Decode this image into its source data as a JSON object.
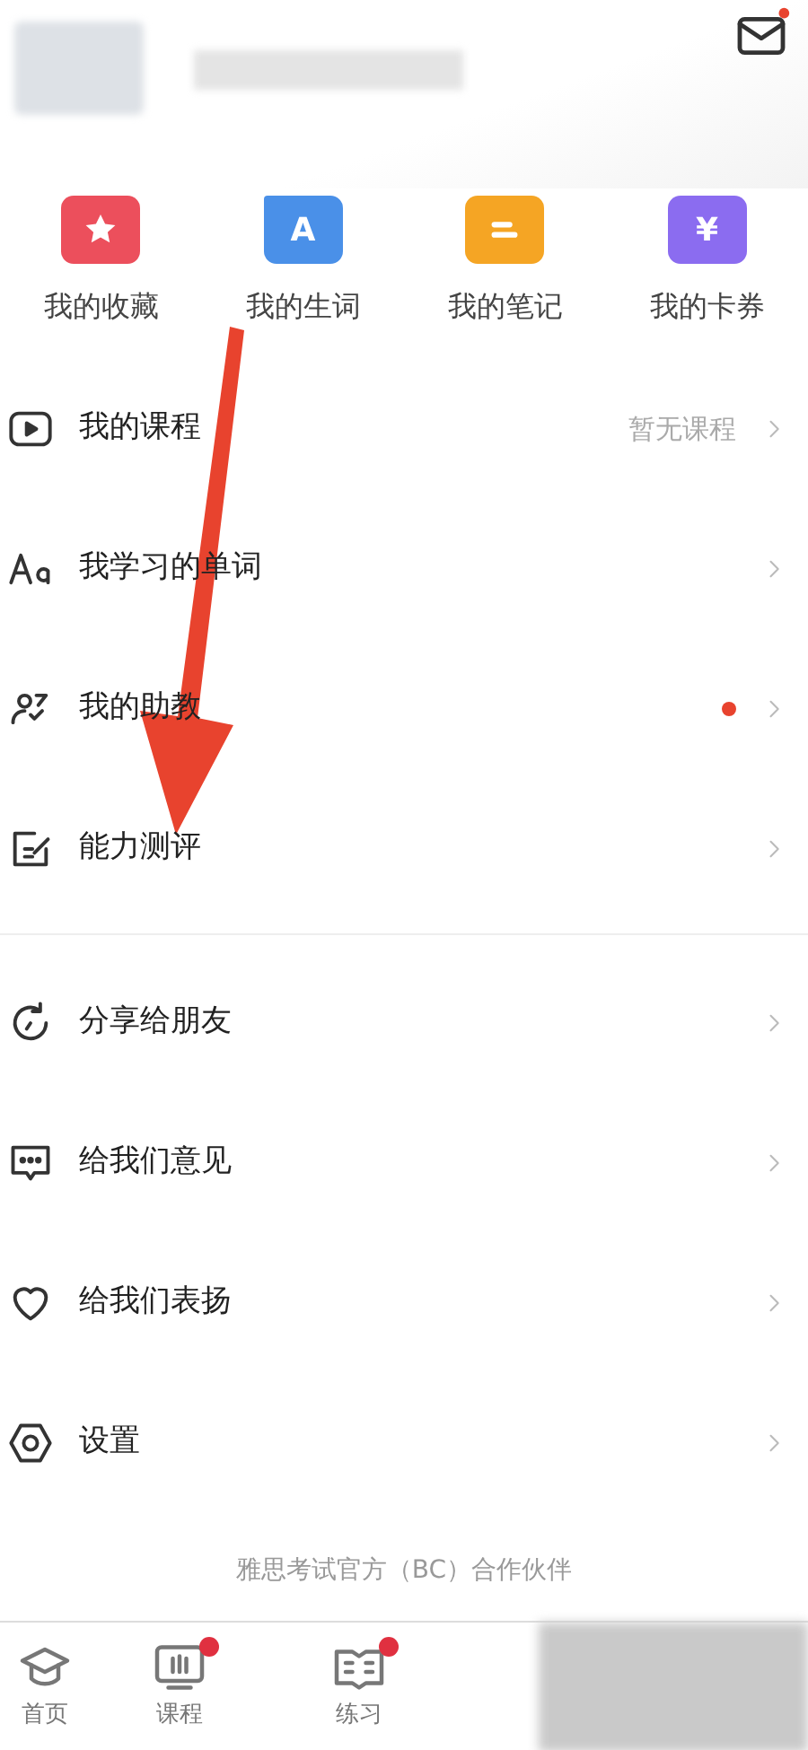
{
  "header": {
    "mail_badge": true
  },
  "shortcuts": [
    {
      "label": "我的收藏",
      "kind": "star",
      "color": "#ec4f5c"
    },
    {
      "label": "我的生词",
      "kind": "folder",
      "glyph": "A",
      "color": "#4a90e8"
    },
    {
      "label": "我的笔记",
      "kind": "lines",
      "color": "#f5a524"
    },
    {
      "label": "我的卡券",
      "kind": "box",
      "glyph": "¥",
      "color": "#8b6cf0"
    }
  ],
  "menu_groups": [
    {
      "items": [
        {
          "label": "我的课程",
          "value": "暂无课程",
          "dot": false
        },
        {
          "label": "我学习的单词",
          "dot": false
        },
        {
          "label": "我的助教",
          "dot": true
        },
        {
          "label": "能力测评",
          "dot": false
        }
      ]
    },
    {
      "items": [
        {
          "label": "分享给朋友",
          "dot": false
        },
        {
          "label": "给我们意见",
          "dot": false
        },
        {
          "label": "给我们表扬",
          "dot": false
        },
        {
          "label": "设置",
          "dot": false
        }
      ]
    }
  ],
  "footer_text": "雅思考试官方（BC）合作伙伴",
  "tabs": [
    {
      "label": "首页",
      "badge": false
    },
    {
      "label": "课程",
      "badge": true
    },
    {
      "label": "练习",
      "badge": true
    }
  ],
  "annotation": {
    "color": "#e8432e"
  }
}
